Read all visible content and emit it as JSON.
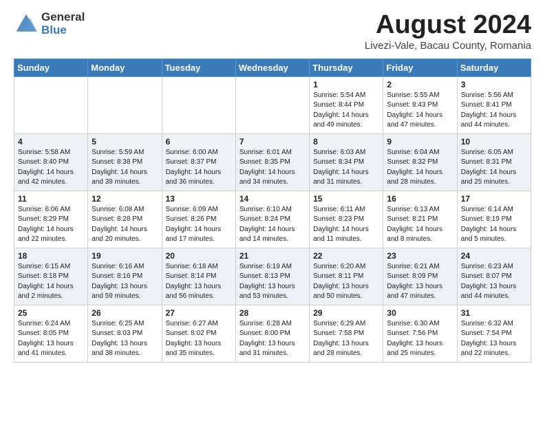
{
  "header": {
    "logo_general": "General",
    "logo_blue": "Blue",
    "month_year": "August 2024",
    "location": "Livezi-Vale, Bacau County, Romania"
  },
  "weekdays": [
    "Sunday",
    "Monday",
    "Tuesday",
    "Wednesday",
    "Thursday",
    "Friday",
    "Saturday"
  ],
  "weeks": [
    [
      {
        "day": "",
        "info": ""
      },
      {
        "day": "",
        "info": ""
      },
      {
        "day": "",
        "info": ""
      },
      {
        "day": "",
        "info": ""
      },
      {
        "day": "1",
        "info": "Sunrise: 5:54 AM\nSunset: 8:44 PM\nDaylight: 14 hours\nand 49 minutes."
      },
      {
        "day": "2",
        "info": "Sunrise: 5:55 AM\nSunset: 8:43 PM\nDaylight: 14 hours\nand 47 minutes."
      },
      {
        "day": "3",
        "info": "Sunrise: 5:56 AM\nSunset: 8:41 PM\nDaylight: 14 hours\nand 44 minutes."
      }
    ],
    [
      {
        "day": "4",
        "info": "Sunrise: 5:58 AM\nSunset: 8:40 PM\nDaylight: 14 hours\nand 42 minutes."
      },
      {
        "day": "5",
        "info": "Sunrise: 5:59 AM\nSunset: 8:38 PM\nDaylight: 14 hours\nand 39 minutes."
      },
      {
        "day": "6",
        "info": "Sunrise: 6:00 AM\nSunset: 8:37 PM\nDaylight: 14 hours\nand 36 minutes."
      },
      {
        "day": "7",
        "info": "Sunrise: 6:01 AM\nSunset: 8:35 PM\nDaylight: 14 hours\nand 34 minutes."
      },
      {
        "day": "8",
        "info": "Sunrise: 6:03 AM\nSunset: 8:34 PM\nDaylight: 14 hours\nand 31 minutes."
      },
      {
        "day": "9",
        "info": "Sunrise: 6:04 AM\nSunset: 8:32 PM\nDaylight: 14 hours\nand 28 minutes."
      },
      {
        "day": "10",
        "info": "Sunrise: 6:05 AM\nSunset: 8:31 PM\nDaylight: 14 hours\nand 25 minutes."
      }
    ],
    [
      {
        "day": "11",
        "info": "Sunrise: 6:06 AM\nSunset: 8:29 PM\nDaylight: 14 hours\nand 22 minutes."
      },
      {
        "day": "12",
        "info": "Sunrise: 6:08 AM\nSunset: 8:28 PM\nDaylight: 14 hours\nand 20 minutes."
      },
      {
        "day": "13",
        "info": "Sunrise: 6:09 AM\nSunset: 8:26 PM\nDaylight: 14 hours\nand 17 minutes."
      },
      {
        "day": "14",
        "info": "Sunrise: 6:10 AM\nSunset: 8:24 PM\nDaylight: 14 hours\nand 14 minutes."
      },
      {
        "day": "15",
        "info": "Sunrise: 6:11 AM\nSunset: 8:23 PM\nDaylight: 14 hours\nand 11 minutes."
      },
      {
        "day": "16",
        "info": "Sunrise: 6:13 AM\nSunset: 8:21 PM\nDaylight: 14 hours\nand 8 minutes."
      },
      {
        "day": "17",
        "info": "Sunrise: 6:14 AM\nSunset: 8:19 PM\nDaylight: 14 hours\nand 5 minutes."
      }
    ],
    [
      {
        "day": "18",
        "info": "Sunrise: 6:15 AM\nSunset: 8:18 PM\nDaylight: 14 hours\nand 2 minutes."
      },
      {
        "day": "19",
        "info": "Sunrise: 6:16 AM\nSunset: 8:16 PM\nDaylight: 13 hours\nand 59 minutes."
      },
      {
        "day": "20",
        "info": "Sunrise: 6:18 AM\nSunset: 8:14 PM\nDaylight: 13 hours\nand 56 minutes."
      },
      {
        "day": "21",
        "info": "Sunrise: 6:19 AM\nSunset: 8:13 PM\nDaylight: 13 hours\nand 53 minutes."
      },
      {
        "day": "22",
        "info": "Sunrise: 6:20 AM\nSunset: 8:11 PM\nDaylight: 13 hours\nand 50 minutes."
      },
      {
        "day": "23",
        "info": "Sunrise: 6:21 AM\nSunset: 8:09 PM\nDaylight: 13 hours\nand 47 minutes."
      },
      {
        "day": "24",
        "info": "Sunrise: 6:23 AM\nSunset: 8:07 PM\nDaylight: 13 hours\nand 44 minutes."
      }
    ],
    [
      {
        "day": "25",
        "info": "Sunrise: 6:24 AM\nSunset: 8:05 PM\nDaylight: 13 hours\nand 41 minutes."
      },
      {
        "day": "26",
        "info": "Sunrise: 6:25 AM\nSunset: 8:03 PM\nDaylight: 13 hours\nand 38 minutes."
      },
      {
        "day": "27",
        "info": "Sunrise: 6:27 AM\nSunset: 8:02 PM\nDaylight: 13 hours\nand 35 minutes."
      },
      {
        "day": "28",
        "info": "Sunrise: 6:28 AM\nSunset: 8:00 PM\nDaylight: 13 hours\nand 31 minutes."
      },
      {
        "day": "29",
        "info": "Sunrise: 6:29 AM\nSunset: 7:58 PM\nDaylight: 13 hours\nand 28 minutes."
      },
      {
        "day": "30",
        "info": "Sunrise: 6:30 AM\nSunset: 7:56 PM\nDaylight: 13 hours\nand 25 minutes."
      },
      {
        "day": "31",
        "info": "Sunrise: 6:32 AM\nSunset: 7:54 PM\nDaylight: 13 hours\nand 22 minutes."
      }
    ]
  ]
}
